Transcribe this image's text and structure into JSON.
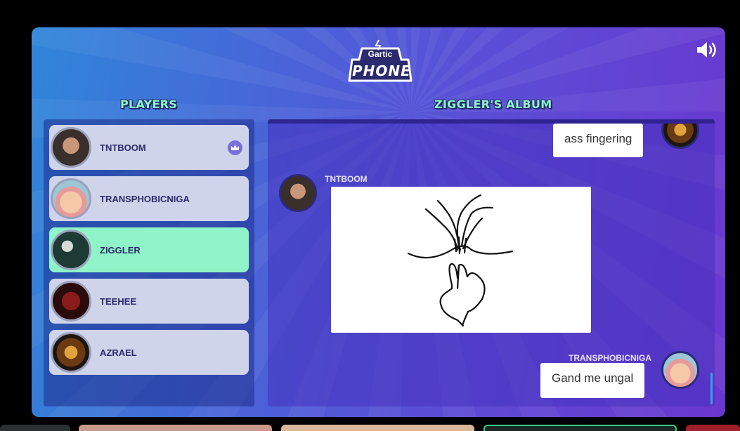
{
  "app": {
    "logo_top": "Gartic",
    "logo_bottom": "PHONE"
  },
  "players": {
    "title": "PLAYERS",
    "list": [
      {
        "name": "TNTBOOM",
        "host": true,
        "active": false
      },
      {
        "name": "TRANSPHOBICNIGA",
        "host": false,
        "active": false
      },
      {
        "name": "ZIGGLER",
        "host": false,
        "active": true
      },
      {
        "name": "TEEHEE",
        "host": false,
        "active": false
      },
      {
        "name": "AZRAEL",
        "host": false,
        "active": false
      }
    ]
  },
  "album": {
    "title": "ZIGGLER'S ALBUM",
    "messages": [
      {
        "author": "",
        "text": "ass fingering",
        "type": "text"
      },
      {
        "author": "TNTBOOM",
        "text": "",
        "type": "drawing"
      },
      {
        "author": "TRANSPHOBICNIGA",
        "text": "Gand me ungal",
        "type": "text"
      }
    ]
  },
  "icons": {
    "sound": "speaker-icon",
    "host": "crown-icon"
  },
  "colors": {
    "accent_green": "#8ff5c8",
    "player_card": "#cfd4ea",
    "title_outline": "#1f2a6b"
  }
}
